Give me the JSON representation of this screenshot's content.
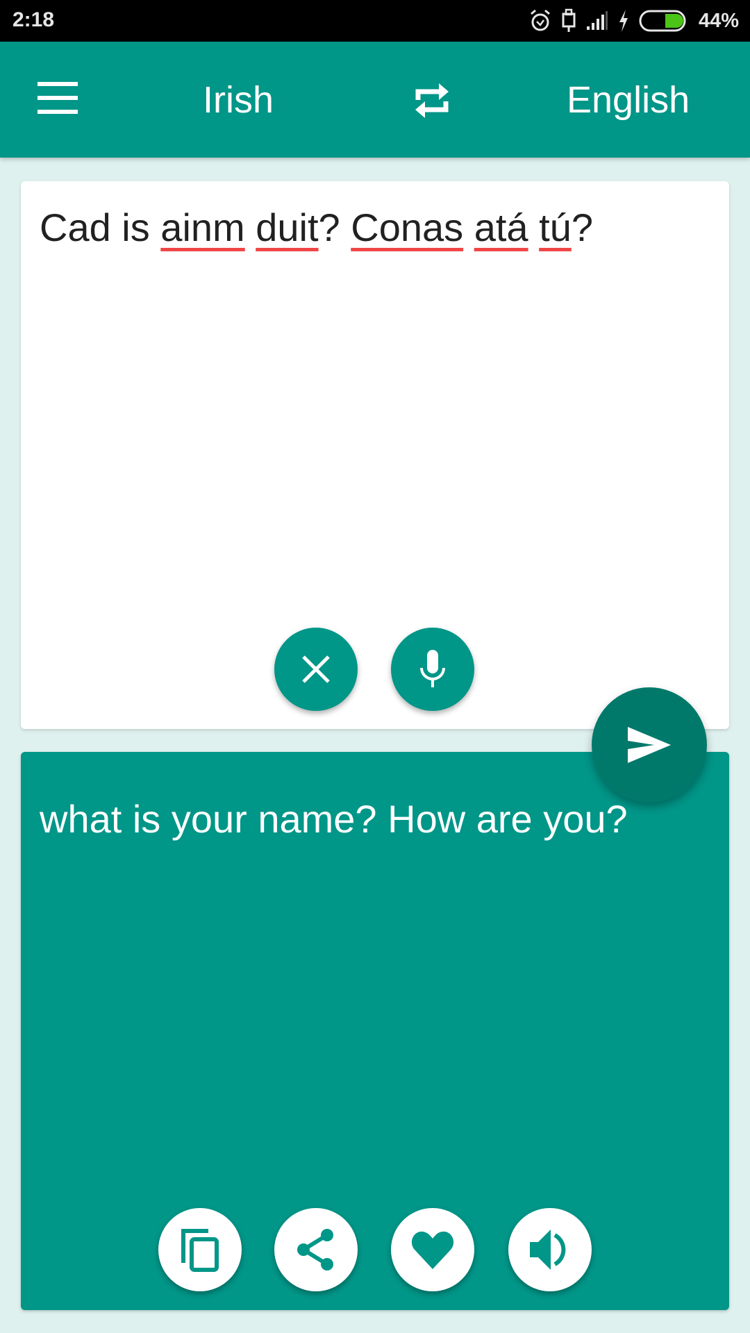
{
  "status_bar": {
    "time": "2:18",
    "battery_percent": "44%",
    "battery_level": 0.44,
    "icons": [
      "alarm-icon",
      "usb-icon",
      "signal-icon",
      "charging-icon",
      "battery-icon"
    ]
  },
  "toolbar": {
    "menu_icon": "menu-icon",
    "source_language": "Irish",
    "swap_icon": "swap-icon",
    "target_language": "English"
  },
  "input": {
    "words": [
      {
        "text": "Cad is ",
        "misspelled": false
      },
      {
        "text": "ainm",
        "misspelled": true
      },
      {
        "text": " ",
        "misspelled": false
      },
      {
        "text": "duit",
        "misspelled": true
      },
      {
        "text": "? ",
        "misspelled": false
      },
      {
        "text": "Conas",
        "misspelled": true
      },
      {
        "text": " ",
        "misspelled": false
      },
      {
        "text": "atá",
        "misspelled": true
      },
      {
        "text": " ",
        "misspelled": false
      },
      {
        "text": "tú",
        "misspelled": true
      },
      {
        "text": "?",
        "misspelled": false
      }
    ],
    "buttons": [
      {
        "name": "clear",
        "icon": "close-icon"
      },
      {
        "name": "voice-input",
        "icon": "microphone-icon"
      }
    ]
  },
  "translate_button": {
    "icon": "send-icon"
  },
  "output": {
    "text": "what is your name? How are you?",
    "buttons": [
      {
        "name": "copy",
        "icon": "copy-icon"
      },
      {
        "name": "share",
        "icon": "share-icon"
      },
      {
        "name": "favorite",
        "icon": "heart-icon"
      },
      {
        "name": "speak",
        "icon": "speaker-icon"
      }
    ]
  },
  "colors": {
    "primary": "#009688",
    "primary_dark": "#00796b",
    "background": "#dff1ee",
    "spell_error": "#f04646",
    "battery_fill": "#4cc417"
  }
}
